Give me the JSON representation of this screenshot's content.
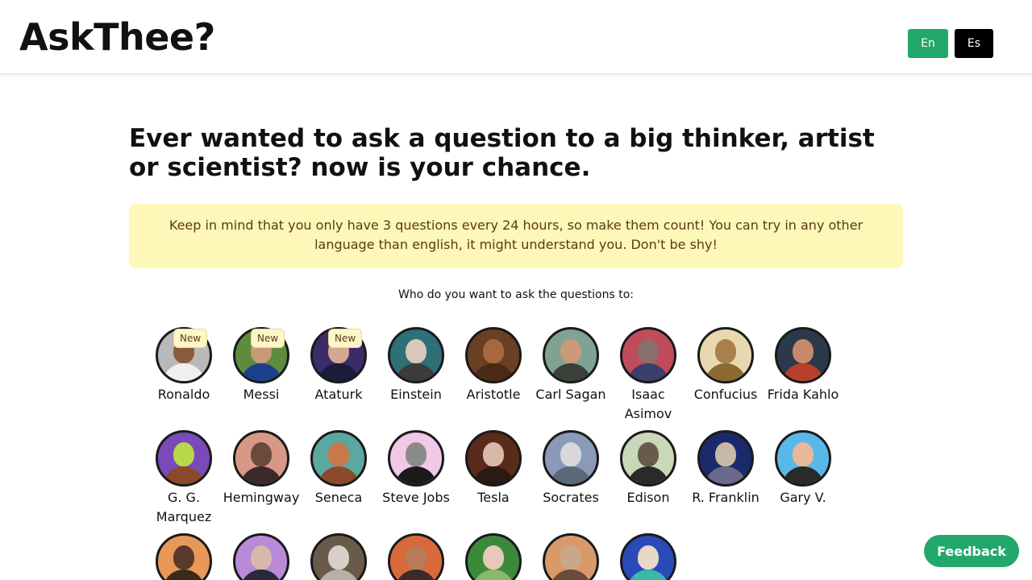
{
  "header": {
    "logo": "AskThee?",
    "languages": [
      {
        "label": "En",
        "color": "#22a86b"
      },
      {
        "label": "Es",
        "color": "#000000"
      }
    ]
  },
  "main": {
    "headline": "Ever wanted to ask a question to a big thinker, artist or scientist? now is your chance.",
    "notice": "Keep in mind that you only have 3 questions every 24 hours, so make them count!  You can try in any other language than english, it might understand you. Don't be shy!",
    "prompt": "Who do you want to ask the questions to:",
    "badge_label": "New",
    "people": [
      {
        "name": "Ronaldo",
        "badge": "New",
        "bg": "#b9b9b9",
        "face": "#8a5a3c",
        "body": "#f0f0f0"
      },
      {
        "name": "Messi",
        "badge": "New",
        "bg": "#5f8b3f",
        "face": "#c79a7a",
        "body": "#1b3f8a"
      },
      {
        "name": "Ataturk",
        "badge": "New",
        "bg": "#3b2b6b",
        "face": "#d2a890",
        "body": "#1b1b3b"
      },
      {
        "name": "Einstein",
        "bg": "#2e6f78",
        "face": "#d8c8b8",
        "body": "#3b3b3b"
      },
      {
        "name": "Aristotle",
        "bg": "#6b3f23",
        "face": "#a8683f",
        "body": "#4a2a16"
      },
      {
        "name": "Carl Sagan",
        "bg": "#7fa392",
        "face": "#c89a7a",
        "body": "#3a3f3a"
      },
      {
        "name": "Isaac Asimov",
        "bg": "#c04b5a",
        "face": "#8b6f6a",
        "body": "#3b3f6b"
      },
      {
        "name": "Confucius",
        "bg": "#e8d8b0",
        "face": "#a8804a",
        "body": "#8a6a30"
      },
      {
        "name": "Frida Kahlo",
        "bg": "#2a3a4a",
        "face": "#c8886a",
        "body": "#b8402a"
      },
      {
        "name": "G. G. Marquez",
        "bg": "#7a4ab8",
        "face": "#b8d84a",
        "body": "#8a4a2a"
      },
      {
        "name": "Hemingway",
        "bg": "#d89888",
        "face": "#6a4a3a",
        "body": "#3a2a2a"
      },
      {
        "name": "Seneca",
        "bg": "#5aa8a0",
        "face": "#c8784a",
        "body": "#8a4a2a"
      },
      {
        "name": "Steve Jobs",
        "bg": "#f0c8e8",
        "face": "#8a8a8a",
        "body": "#1a1a1a"
      },
      {
        "name": "Tesla",
        "bg": "#5a2a1a",
        "face": "#d8b8a8",
        "body": "#2a1a14"
      },
      {
        "name": "Socrates",
        "bg": "#8a9ab8",
        "face": "#d8d8d8",
        "body": "#5a6a7a"
      },
      {
        "name": "Edison",
        "bg": "#c8d8b8",
        "face": "#6a5a4a",
        "body": "#2a2a2a"
      },
      {
        "name": "R. Franklin",
        "bg": "#1a2a6a",
        "face": "#c8b8a8",
        "body": "#6a6a8a"
      },
      {
        "name": "Gary V.",
        "bg": "#5ab8e8",
        "face": "#e8b898",
        "body": "#2a2a2a"
      },
      {
        "name": "",
        "bg": "#e89858",
        "face": "#5a3a2a",
        "body": "#3a2a1a"
      },
      {
        "name": "",
        "bg": "#b88ad8",
        "face": "#d8b8a8",
        "body": "#2a2a3a"
      },
      {
        "name": "",
        "bg": "#6a5a4a",
        "face": "#d8d0c8",
        "body": "#b8b0a8"
      },
      {
        "name": "",
        "bg": "#d86a3a",
        "face": "#b87a5a",
        "body": "#3a2a2a"
      },
      {
        "name": "",
        "bg": "#3a8a3a",
        "face": "#e8c8b8",
        "body": "#8ab86a"
      },
      {
        "name": "",
        "bg": "#d89a6a",
        "face": "#c8a888",
        "body": "#6a4a3a"
      },
      {
        "name": "",
        "bg": "#2a4ab8",
        "face": "#e8d8c8",
        "body": "#3ab8a8"
      }
    ]
  },
  "feedback": {
    "label": "Feedback"
  }
}
